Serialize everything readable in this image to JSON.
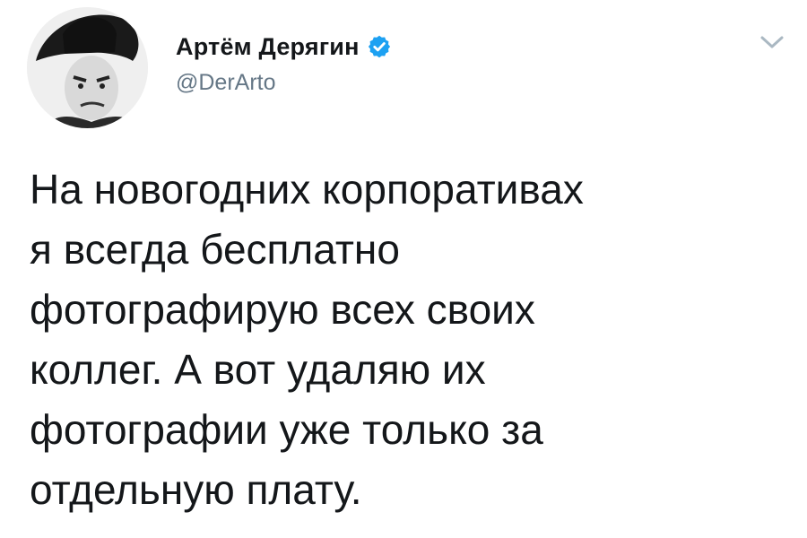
{
  "author": {
    "display_name": "Артём Дерягин",
    "handle": "@DerArto",
    "verified": true
  },
  "tweet": {
    "text": "На новогодних корпоративах\nя всегда бесплатно\nфотографирую всех своих\nколлег. А вот удаляю их\nфотографии уже только за\nотдельную плату."
  },
  "icons": {
    "avatar": "avatar-photo",
    "verified": "verified-badge-icon",
    "menu": "chevron-down-icon"
  },
  "colors": {
    "verified_blue": "#1da1f2",
    "handle_gray": "#657786",
    "text": "#14171a",
    "caret_gray": "#aab8c2"
  }
}
